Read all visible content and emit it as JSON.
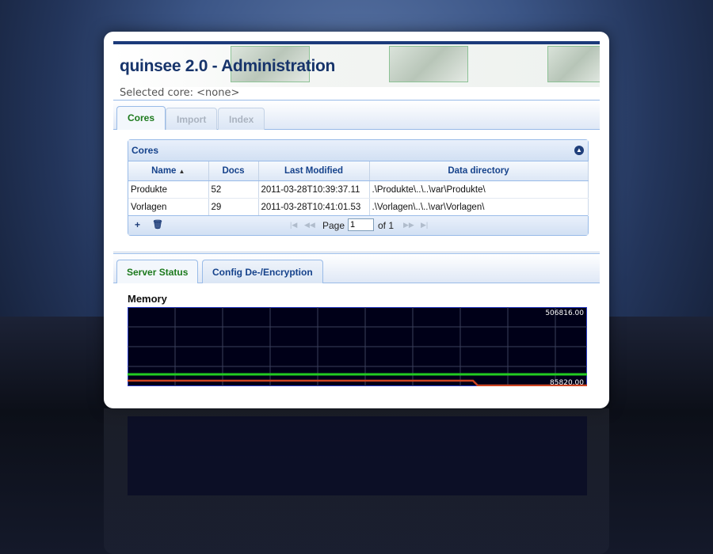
{
  "app": {
    "title": "quinsee 2.0 - Administration",
    "selected_core": "Selected core: <none>"
  },
  "top_tabs": [
    {
      "label": "Cores",
      "active": true
    },
    {
      "label": "Import",
      "active": false
    },
    {
      "label": "Index",
      "active": false
    }
  ],
  "cores_panel": {
    "title": "Cores",
    "columns": [
      "Name",
      "Docs",
      "Last Modified",
      "Data directory"
    ],
    "rows": [
      [
        "Produkte",
        "52",
        "2011-03-28T10:39:37.11",
        ".\\Produkte\\..\\..\\var\\Produkte\\"
      ],
      [
        "Vorlagen",
        "29",
        "2011-03-28T10:41:01.53",
        ".\\Vorlagen\\..\\..\\var\\Vorlagen\\"
      ]
    ],
    "pager": {
      "page_label": "Page",
      "page_value": "1",
      "of_label": "of 1"
    }
  },
  "bottom_tabs": [
    {
      "label": "Server Status",
      "active": true
    },
    {
      "label": "Config De-/Encryption",
      "active": false
    }
  ],
  "memory": {
    "label": "Memory",
    "max_label": "506816.00",
    "min_label": "85820.00"
  },
  "colors": {
    "accent_green": "#1d7a1d",
    "header_blue": "#15428b",
    "series_green": "#22cc22",
    "series_red": "#cc4422"
  },
  "icons": [
    "add-icon",
    "delete-icon",
    "collapse-icon",
    "sort-asc-icon",
    "first-page-icon",
    "prev-page-icon",
    "next-page-icon",
    "last-page-icon"
  ]
}
